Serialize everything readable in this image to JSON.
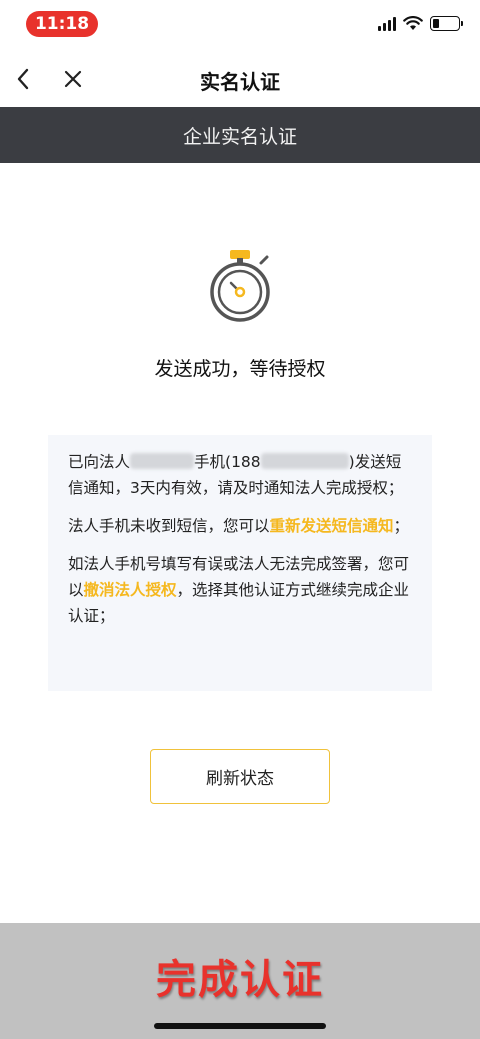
{
  "status_bar": {
    "time": "11:18",
    "battery_level": 0.25
  },
  "nav": {
    "title": "实名认证",
    "back_icon": "chevron-left-icon",
    "close_icon": "close-icon"
  },
  "section": {
    "title": "企业实名认证"
  },
  "main": {
    "status_icon": "stopwatch-icon",
    "status_text": "发送成功，等待授权",
    "info": {
      "p1_prefix": "已向法人",
      "p1_mid": "手机(188",
      "p1_suffix": ")发送短信通知，3天内有效，请及时通知法人完成授权；",
      "p2_prefix": "法人手机未收到短信，您可以",
      "p2_link": "重新发送短信通知",
      "p2_suffix": "；",
      "p3_prefix": "如法人手机号填写有误或法人无法完成签署，您可以",
      "p3_link": "撤消法人授权",
      "p3_suffix": "，选择其他认证方式继续完成企业认证；"
    },
    "refresh_label": "刷新状态"
  },
  "footer": {
    "complete_label": "完成认证"
  },
  "colors": {
    "accent": "#f5b81f",
    "section_bg": "#3b3d42",
    "time_pill": "#e8322c",
    "footer_label": "#e8322c"
  }
}
